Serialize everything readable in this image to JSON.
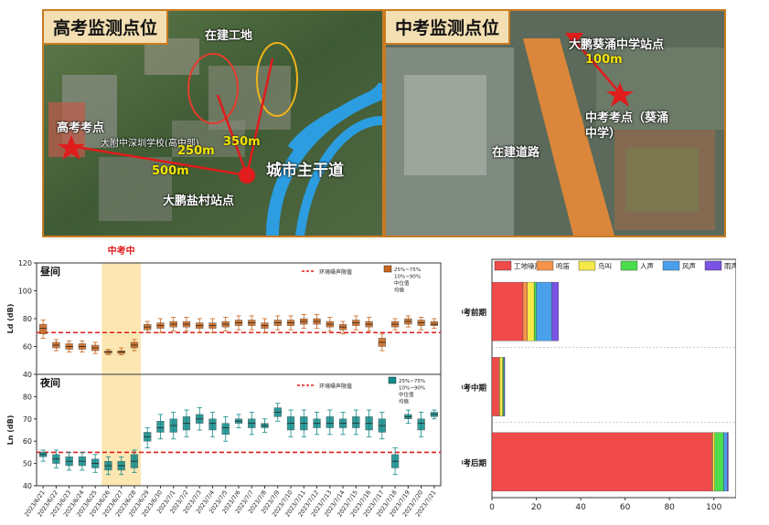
{
  "maps": {
    "left": {
      "title": "高考监测点位",
      "labels": {
        "construction_site": "在建工地",
        "exam_point": "高考考点",
        "school": "大附中深圳学校(高中部)",
        "main_road": "城市主干道",
        "station": "大鹏盐村站点",
        "dist_250": "250m",
        "dist_350": "350m",
        "dist_500": "500m"
      }
    },
    "right": {
      "title": "中考监测点位",
      "labels": {
        "station": "大鹏葵涌中学站点",
        "dist_100": "100m",
        "exam_point_line1": "中考考点（葵涌",
        "exam_point_line2": "中学）",
        "road_under_construction": "在建道路"
      }
    }
  },
  "chart_data": [
    {
      "type": "box",
      "period_label": "中考中",
      "highlight_range": [
        "2023/6/26",
        "2023/6/28"
      ],
      "x": [
        "2023/6/21",
        "2023/6/22",
        "2023/6/23",
        "2023/6/24",
        "2023/6/25",
        "2023/6/26",
        "2023/6/27",
        "2023/6/28",
        "2023/6/29",
        "2023/6/30",
        "2023/7/1",
        "2023/7/2",
        "2023/7/3",
        "2023/7/4",
        "2023/7/5",
        "2023/7/6",
        "2023/7/7",
        "2023/7/8",
        "2023/7/9",
        "2023/7/10",
        "2023/7/11",
        "2023/7/12",
        "2023/7/13",
        "2023/7/14",
        "2023/7/15",
        "2023/7/16",
        "2023/7/17",
        "2023/7/18",
        "2023/7/19",
        "2023/7/20",
        "2023/7/21"
      ],
      "panels": [
        {
          "title": "昼间",
          "ylabel": "Ld (dB)",
          "ylim": [
            40,
            120
          ],
          "yticks": [
            40,
            60,
            80,
            100,
            120
          ],
          "limit_line": 70,
          "limit_label": "环境噪声限值",
          "color": "#c8641a",
          "legend": [
            "25%~75%",
            "10%~90%",
            "中位值",
            "均值"
          ],
          "median": [
            73,
            61,
            60,
            60,
            59,
            56,
            56,
            61,
            74,
            75,
            76,
            76,
            75,
            75,
            76,
            77,
            77,
            75,
            77,
            77,
            78,
            78,
            76,
            74,
            77,
            76,
            63,
            76,
            78,
            77,
            76
          ],
          "q1": [
            69,
            59,
            58,
            58,
            57,
            55,
            55,
            59,
            72,
            73,
            74,
            74,
            73,
            73,
            74,
            75,
            75,
            73,
            75,
            75,
            76,
            76,
            74,
            72,
            75,
            74,
            60,
            74,
            76,
            75,
            75
          ],
          "q3": [
            76,
            63,
            62,
            62,
            61,
            57,
            57,
            63,
            76,
            77,
            78,
            78,
            77,
            77,
            78,
            79,
            79,
            77,
            79,
            79,
            80,
            80,
            78,
            76,
            79,
            78,
            66,
            78,
            80,
            79,
            78
          ],
          "low": [
            66,
            57,
            56,
            56,
            55,
            54,
            54,
            57,
            70,
            70,
            71,
            71,
            70,
            70,
            71,
            72,
            72,
            70,
            72,
            72,
            73,
            73,
            71,
            69,
            72,
            71,
            57,
            72,
            74,
            72,
            73
          ],
          "high": [
            79,
            65,
            64,
            64,
            63,
            58,
            59,
            65,
            78,
            80,
            81,
            81,
            80,
            80,
            81,
            82,
            82,
            80,
            82,
            82,
            83,
            83,
            81,
            78,
            82,
            81,
            69,
            80,
            82,
            81,
            80
          ]
        },
        {
          "title": "夜间",
          "ylabel": "Ln (dB)",
          "ylim": [
            40,
            90
          ],
          "yticks": [
            40,
            50,
            60,
            70,
            80,
            90
          ],
          "limit_line": 55,
          "limit_label": "环境噪声限值",
          "color": "#0f8a8a",
          "legend": [
            "25%~75%",
            "10%~90%",
            "中位值",
            "均值"
          ],
          "median": [
            54,
            52,
            51,
            51,
            50,
            49,
            49,
            51,
            62,
            66,
            67,
            68,
            70,
            68,
            66,
            69,
            68,
            67,
            73,
            68,
            68,
            68,
            68,
            68,
            68,
            68,
            67,
            51,
            71,
            68,
            72
          ],
          "q1": [
            53,
            50,
            49,
            49,
            48,
            47,
            47,
            48,
            60,
            64,
            64,
            65,
            68,
            65,
            63,
            68,
            66,
            66,
            71,
            65,
            65,
            66,
            66,
            66,
            66,
            65,
            64,
            48,
            70,
            65,
            71
          ],
          "q3": [
            55,
            54,
            53,
            53,
            52,
            51,
            51,
            54,
            64,
            69,
            70,
            71,
            72,
            70,
            68,
            70,
            70,
            68,
            75,
            71,
            71,
            70,
            71,
            70,
            71,
            71,
            70,
            54,
            72,
            70,
            73
          ],
          "low": [
            51,
            48,
            47,
            47,
            46,
            45,
            45,
            46,
            57,
            61,
            61,
            62,
            65,
            62,
            60,
            66,
            63,
            64,
            69,
            62,
            62,
            63,
            63,
            63,
            63,
            62,
            61,
            45,
            68,
            62,
            70
          ],
          "high": [
            56,
            56,
            55,
            55,
            54,
            53,
            53,
            56,
            66,
            72,
            73,
            74,
            75,
            73,
            71,
            72,
            73,
            70,
            77,
            74,
            74,
            73,
            74,
            73,
            74,
            74,
            73,
            57,
            74,
            73,
            74
          ]
        }
      ]
    },
    {
      "type": "stacked_bar_horizontal",
      "categories": [
        "中考前期",
        "中考中期",
        "中考后期"
      ],
      "xlim": [
        0,
        110
      ],
      "xticks": [
        0,
        20,
        40,
        60,
        80,
        100
      ],
      "series": [
        {
          "name": "工地噪声",
          "color": "#f04a4a",
          "values": [
            14,
            3,
            99
          ]
        },
        {
          "name": "鸣笛",
          "color": "#f5934a",
          "values": [
            2,
            0.6,
            0.6
          ]
        },
        {
          "name": "鸟叫",
          "color": "#f6ea49",
          "values": [
            3,
            1.2,
            0.8
          ]
        },
        {
          "name": "人声",
          "color": "#4cdc4c",
          "values": [
            1,
            0.5,
            4
          ]
        },
        {
          "name": "风声",
          "color": "#4aa0ea",
          "values": [
            7,
            0.3,
            1.6
          ]
        },
        {
          "name": "雨声",
          "color": "#7a52e4",
          "values": [
            3,
            0.2,
            0.5
          ]
        }
      ]
    }
  ]
}
